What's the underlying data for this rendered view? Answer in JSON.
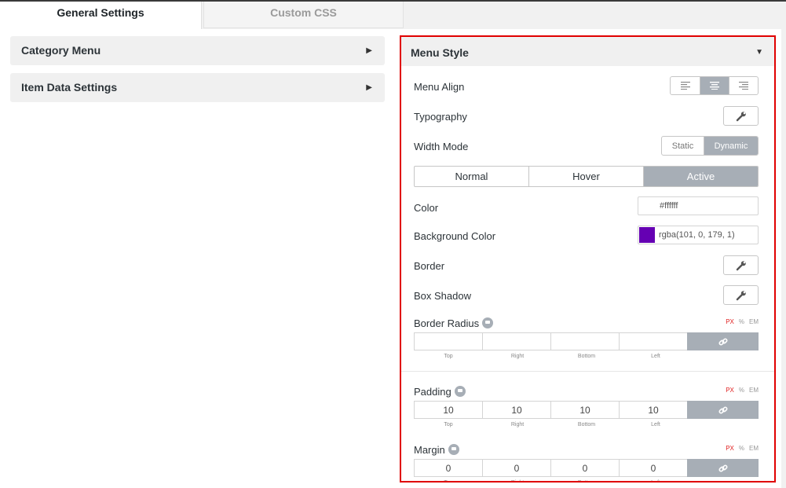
{
  "tabs": [
    {
      "label": "General Settings",
      "active": true
    },
    {
      "label": "Custom CSS",
      "active": false
    }
  ],
  "left_sections": [
    {
      "label": "Category Menu"
    },
    {
      "label": "Item Data Settings"
    }
  ],
  "panel": {
    "title": "Menu Style",
    "menu_align": {
      "label": "Menu Align",
      "options": [
        "align-left-icon",
        "align-center-icon",
        "align-right-icon"
      ],
      "selected": "align-center-icon"
    },
    "typography": {
      "label": "Typography"
    },
    "width_mode": {
      "label": "Width Mode",
      "options": [
        "Static",
        "Dynamic"
      ],
      "selected": "Dynamic"
    },
    "states": {
      "options": [
        "Normal",
        "Hover",
        "Active"
      ],
      "selected": "Active"
    },
    "color": {
      "label": "Color",
      "value": "#ffffff"
    },
    "background_color": {
      "label": "Background Color",
      "value": "rgba(101, 0, 179, 1)",
      "swatch": "#6500b3"
    },
    "border": {
      "label": "Border"
    },
    "box_shadow": {
      "label": "Box Shadow"
    },
    "units": [
      "PX",
      "%",
      "EM"
    ],
    "active_unit": "PX",
    "side_labels": [
      "Top",
      "Right",
      "Bottom",
      "Left"
    ],
    "border_radius": {
      "label": "Border Radius",
      "values": [
        "",
        "",
        "",
        ""
      ]
    },
    "padding": {
      "label": "Padding",
      "values": [
        "10",
        "10",
        "10",
        "10"
      ]
    },
    "margin": {
      "label": "Margin",
      "values": [
        "0",
        "0",
        "0",
        "0"
      ]
    }
  },
  "colors": {
    "accent_border": "#e00000",
    "selected_segment": "#a7aeb6"
  }
}
